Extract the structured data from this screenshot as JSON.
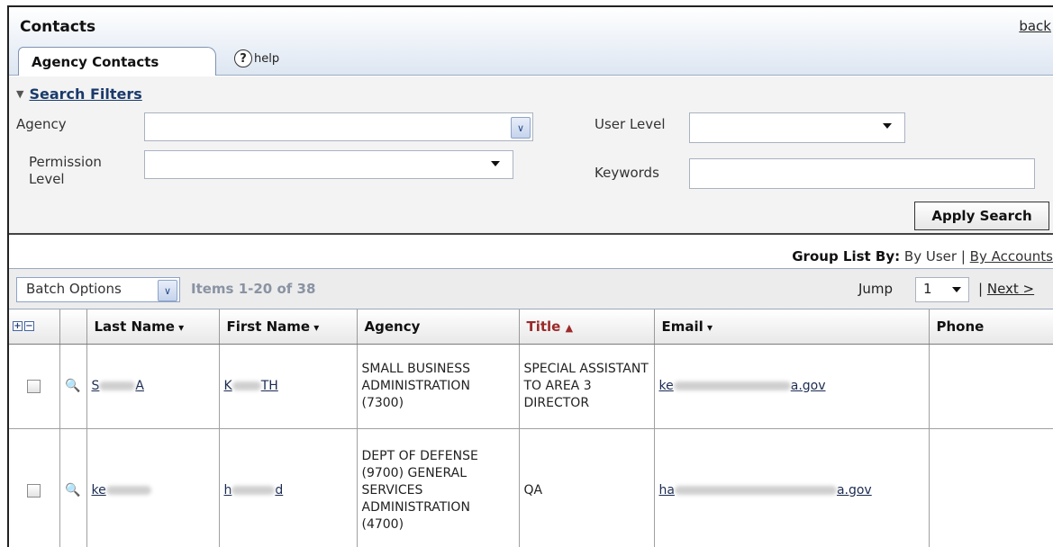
{
  "header": {
    "title": "Contacts",
    "back_link": "back",
    "tab_label": "Agency Contacts",
    "help_icon": "?",
    "help_label": "help"
  },
  "filters": {
    "title": "Search Filters",
    "agency_label": "Agency",
    "agency_value": "",
    "user_level_label": "User Level",
    "user_level_value": "",
    "permission_level_label": "Permission Level",
    "permission_level_value": "",
    "keywords_label": "Keywords",
    "keywords_value": "",
    "apply_button": "Apply Search"
  },
  "group_list": {
    "label": "Group List By:",
    "by_user": "By User",
    "separator": "|",
    "by_accounts": "By Accounts"
  },
  "toolbar": {
    "batch_options": "Batch Options",
    "items_count": "Items 1-20 of 38",
    "jump_label": "Jump",
    "jump_value": "1",
    "separator": "|",
    "next_link": "Next >"
  },
  "table": {
    "columns": [
      "Last Name",
      "First Name",
      "Agency",
      "Title",
      "Email",
      "Phone"
    ],
    "rows": [
      {
        "last_name": "S",
        "last_name_end": "A",
        "first_name": "K",
        "first_name_end": "TH",
        "agency": "SMALL BUSINESS ADMINISTRATION (7300)",
        "title": "SPECIAL ASSISTANT TO AREA 3 DIRECTOR",
        "email": "ke",
        "email_end": "a.gov",
        "phone": ""
      },
      {
        "last_name": "ke",
        "last_name_end": "",
        "first_name": "h",
        "first_name_end": "d",
        "agency": "DEPT OF DEFENSE (9700) GENERAL SERVICES ADMINISTRATION (4700)",
        "title": "QA",
        "email": "ha",
        "email_end": "a.gov",
        "phone": ""
      }
    ]
  },
  "icons": {
    "expand": "+",
    "collapse": "−",
    "combo_arrow": "∨",
    "magnifier": "🔍"
  }
}
